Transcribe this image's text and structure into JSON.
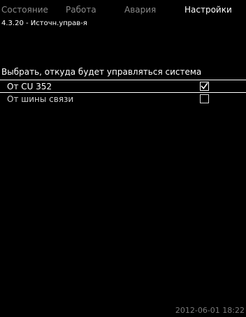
{
  "tabs": [
    {
      "label": "Состояние",
      "active": false
    },
    {
      "label": "Работа",
      "active": false
    },
    {
      "label": "Авария",
      "active": false
    },
    {
      "label": "Настройки",
      "active": true
    }
  ],
  "breadcrumb": "4.3.20 - Источн.управ-я",
  "heading": "Выбрать, откуда будет управляться система",
  "options": [
    {
      "label": "От CU 352",
      "checked": true,
      "selected": true
    },
    {
      "label": "От шины связи",
      "checked": false,
      "selected": false
    }
  ],
  "timestamp": "2012-06-01 18:22",
  "colors": {
    "background": "#000000",
    "text": "#ffffff",
    "inactive_tab": "#8a8a8a",
    "timestamp": "#7a7a7a"
  }
}
